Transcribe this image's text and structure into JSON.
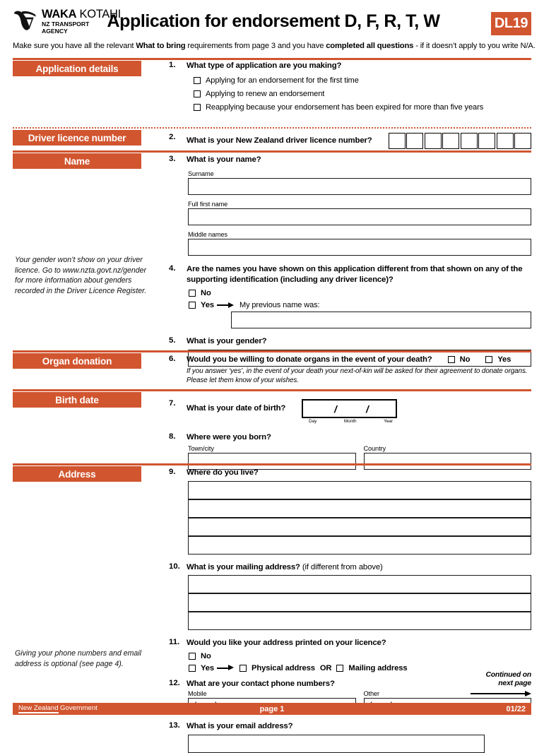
{
  "header": {
    "logo_line1_bold": "WAKA",
    "logo_line1_light": "KOTAHI",
    "logo_line2": "NZ TRANSPORT",
    "logo_line3": "AGENCY",
    "title": "Application for endorsement D, F, R, T, W",
    "badge": "DL19",
    "accent_color": "#d1552f"
  },
  "intro": {
    "part1": "Make sure you have all the relevant ",
    "bold1": "What to bring",
    "part2": " requirements from page 3 and you have ",
    "bold2": "completed all questions",
    "part3": " - if it doesn’t apply to you write N/A."
  },
  "sections": [
    {
      "label": "Application details"
    },
    {
      "label": "Driver licence number"
    },
    {
      "label": "Name"
    },
    {
      "label": "Organ donation"
    },
    {
      "label": "Birth date"
    },
    {
      "label": "Address"
    }
  ],
  "questions": {
    "q1": {
      "num": "1.",
      "text": "What type of application are you making?",
      "options": [
        "Applying for an endorsement for the first time",
        "Applying to renew an endorsement",
        "Reapplying because your endorsement has been expired for more than five years"
      ]
    },
    "q2": {
      "num": "2.",
      "text": "What is your New Zealand driver licence number?",
      "boxes": 8
    },
    "q3": {
      "num": "3.",
      "text": "What is your name?",
      "fields": [
        "Surname",
        "Full first name",
        "Middle names"
      ]
    },
    "q4": {
      "num": "4.",
      "text": "Are the names you have shown on this application different from that shown on any of the supporting identification (including any driver licence)?",
      "no_label": "No",
      "yes_label": "Yes",
      "previous_name_label": "My previous name was:"
    },
    "q5": {
      "num": "5.",
      "text": "What is your gender?"
    },
    "q6": {
      "num": "6.",
      "text": "Would you be willing to donate organs in the event of your death?",
      "no_label": "No",
      "yes_label": "Yes",
      "note": "If you answer ‘yes’, in the event of your death your next-of-kin will be asked for their agreement to donate organs. Please let them know of your wishes."
    },
    "q7": {
      "num": "7.",
      "text": "What is your date of birth?",
      "tick_day": "Day",
      "tick_month": "Month",
      "tick_year": "Year",
      "separator": "/"
    },
    "q8": {
      "num": "8.",
      "text": "Where were you born?",
      "field_town": "Town/city",
      "field_country": "Country"
    },
    "q9": {
      "num": "9.",
      "text": "Where do you live?",
      "lines": 4
    },
    "q10": {
      "num": "10.",
      "text": "What is your mailing address?",
      "text_suffix": " (if different from above)",
      "lines": 3
    },
    "q11": {
      "num": "11.",
      "text": "Would you like your address printed on your licence?",
      "no_label": "No",
      "yes_label": "Yes",
      "physical_label": "Physical address",
      "or_label": "OR",
      "mailing_label": "Mailing address"
    },
    "q12": {
      "num": "12.",
      "text": "What are your contact phone numbers?",
      "field_mobile": "Mobile",
      "field_other": "Other",
      "paren": "(          )"
    },
    "q13": {
      "num": "13.",
      "text": "What is your email address?"
    }
  },
  "sidenotes": {
    "gender": "Your gender won’t show on your driver licence. Go to www.nzta.govt.nz/gender for more information about genders recorded in the Driver Licence Register.",
    "phone": "Giving your phone numbers and email address is optional (see page 4)."
  },
  "continued": {
    "line1": "Continued on",
    "line2": "next page"
  },
  "footer": {
    "gov_underlined": "New Zealand",
    "gov_rest": "Government",
    "page": "page 1",
    "version": "01/22"
  }
}
